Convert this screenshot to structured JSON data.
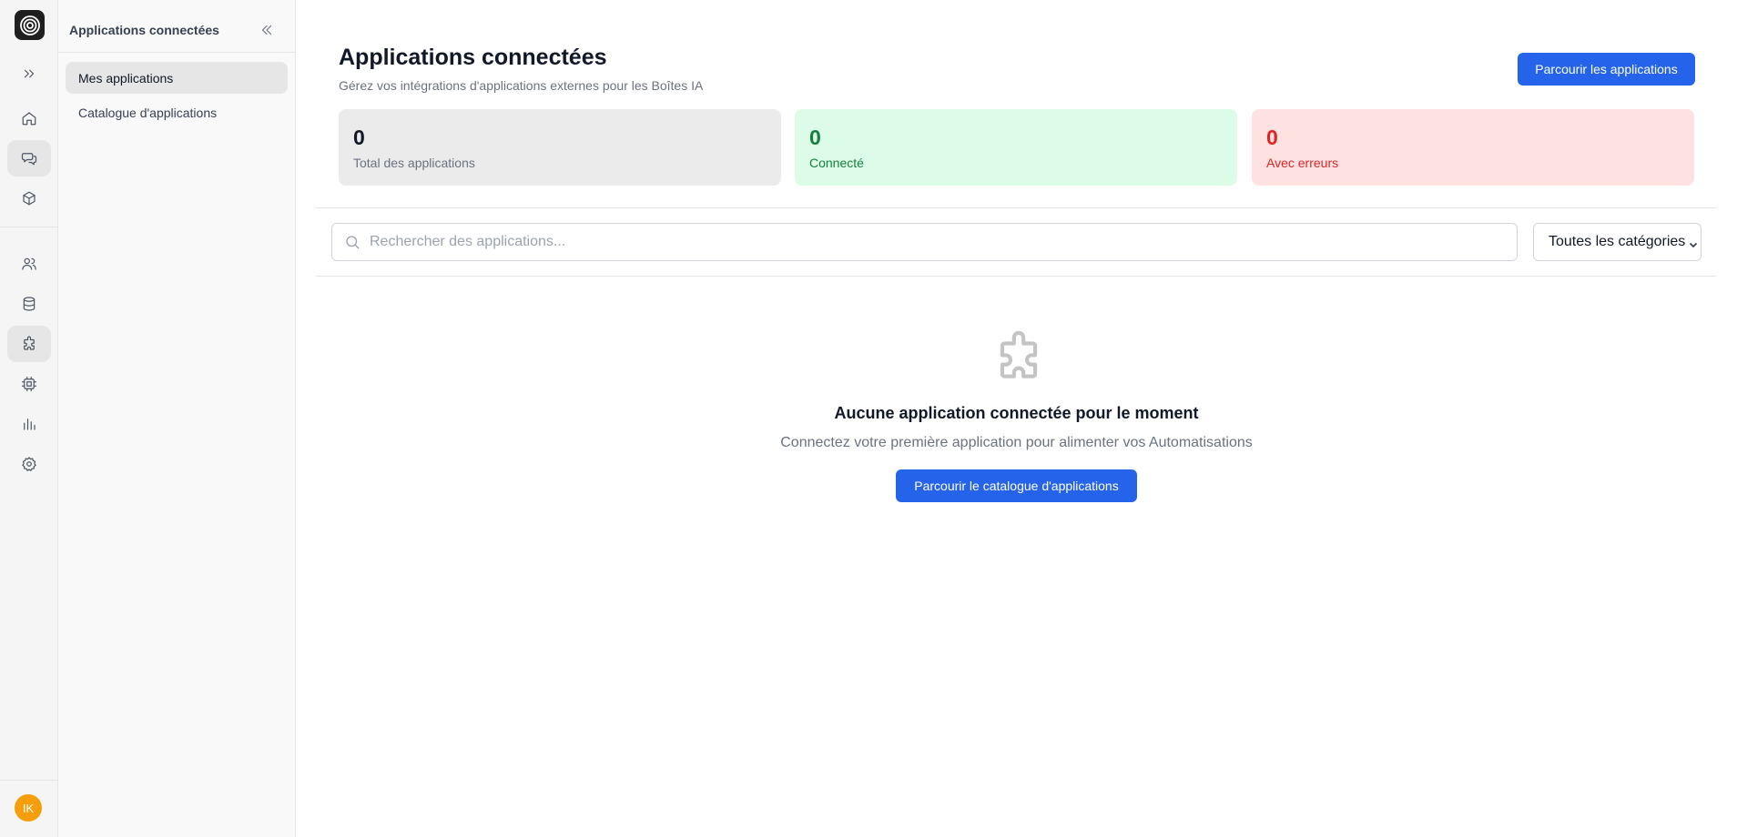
{
  "rail": {
    "icons": [
      "logo-icon",
      "expand-icon",
      "home-icon",
      "chat-icon",
      "cube-icon",
      "users-icon",
      "database-icon",
      "puzzle-icon",
      "chip-icon",
      "bar-chart-icon",
      "gear-icon"
    ],
    "avatar_initials": "IK",
    "avatar_color": "#f59e0b"
  },
  "sidebar": {
    "title": "Applications connectées",
    "items": [
      {
        "label": "Mes applications",
        "active": true
      },
      {
        "label": "Catalogue d'applications",
        "active": false
      }
    ]
  },
  "header": {
    "title": "Applications connectées",
    "subtitle": "Gérez vos intégrations d'applications externes pour les Boîtes IA",
    "browse_button": "Parcourir les applications"
  },
  "stats": {
    "total": {
      "value": "0",
      "label": "Total des applications"
    },
    "connected": {
      "value": "0",
      "label": "Connecté"
    },
    "errors": {
      "value": "0",
      "label": "Avec erreurs"
    }
  },
  "filters": {
    "search_placeholder": "Rechercher des applications...",
    "search_value": "",
    "category_selected": "Toutes les catégories"
  },
  "empty_state": {
    "icon": "puzzle-icon",
    "title": "Aucune application connectée pour le moment",
    "subtitle": "Connectez votre première application pour alimenter vos Automatisations",
    "button": "Parcourir le catalogue d'applications"
  },
  "colors": {
    "accent": "#2563eb",
    "success": "#15803d",
    "success_bg": "#dcfce7",
    "error": "#dc2626",
    "error_bg": "#fee2e2"
  }
}
